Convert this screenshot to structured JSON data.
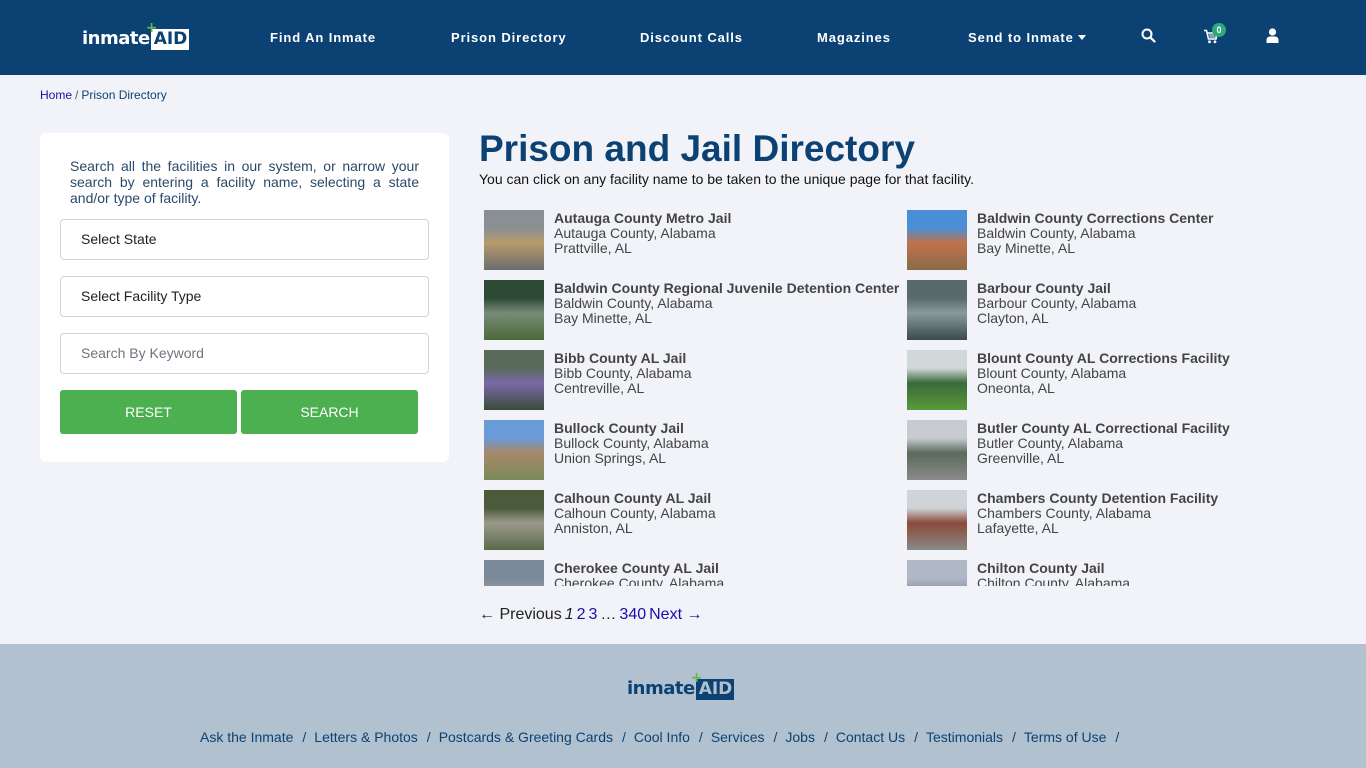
{
  "header": {
    "logo_text": "inmate",
    "logo_accent": "AID",
    "logo_plus": "+",
    "nav": [
      {
        "label": "Find An Inmate"
      },
      {
        "label": "Prison Directory"
      },
      {
        "label": "Discount Calls"
      },
      {
        "label": "Magazines"
      },
      {
        "label": "Send to Inmate",
        "has_dropdown": true
      }
    ],
    "icons": [
      "search-icon",
      "cart-icon",
      "user-icon"
    ],
    "cart_count": "0"
  },
  "breadcrumb": {
    "home": "Home",
    "separator": "/",
    "current": "Prison Directory"
  },
  "search_panel": {
    "description": "Search all the facilities in our system, or narrow your search by entering a facility name, selecting a state and/or type of facility.",
    "state_select": "Select State",
    "type_select": "Select Facility Type",
    "keyword_placeholder": "Search By Keyword",
    "reset_label": "RESET",
    "search_label": "SEARCH"
  },
  "main": {
    "title": "Prison and Jail Directory",
    "subtitle": "You can click on any facility name to be taken to the unique page for that facility.",
    "facilities": [
      {
        "name": "Autauga County Metro Jail",
        "county": "Autauga County, Alabama",
        "city": "Prattville, AL",
        "thumb": [
          "#8a8f94",
          "#b89a6a",
          "#6b6d6e"
        ]
      },
      {
        "name": "Baldwin County Corrections Center",
        "county": "Baldwin County, Alabama",
        "city": "Bay Minette, AL",
        "thumb": [
          "#4a8fd6",
          "#c0724a",
          "#8a6a4a"
        ]
      },
      {
        "name": "Baldwin County Regional Juvenile Detention Center",
        "county": "Baldwin County, Alabama",
        "city": "Bay Minette, AL",
        "thumb": [
          "#2c4a34",
          "#7a8a78",
          "#4a6a3a"
        ]
      },
      {
        "name": "Barbour County Jail",
        "county": "Barbour County, Alabama",
        "city": "Clayton, AL",
        "thumb": [
          "#5a6a6a",
          "#8a9a9a",
          "#3a4a4a"
        ]
      },
      {
        "name": "Bibb County AL Jail",
        "county": "Bibb County, Alabama",
        "city": "Centreville, AL",
        "thumb": [
          "#5a6a5a",
          "#7a6aa8",
          "#3a4a3a"
        ]
      },
      {
        "name": "Blount County AL Corrections Facility",
        "county": "Blount County, Alabama",
        "city": "Oneonta, AL",
        "thumb": [
          "#d0d8d8",
          "#3a6a3a",
          "#5a9a3a"
        ]
      },
      {
        "name": "Bullock County Jail",
        "county": "Bullock County, Alabama",
        "city": "Union Springs, AL",
        "thumb": [
          "#6a9ad8",
          "#a8886a",
          "#7a8a5a"
        ]
      },
      {
        "name": "Butler County AL Correctional Facility",
        "county": "Butler County, Alabama",
        "city": "Greenville, AL",
        "thumb": [
          "#c8ccd0",
          "#5a6a5a",
          "#8a8a8a"
        ]
      },
      {
        "name": "Calhoun County AL Jail",
        "county": "Calhoun County, Alabama",
        "city": "Anniston, AL",
        "thumb": [
          "#4a5a3a",
          "#9a9a8a",
          "#5a6a4a"
        ]
      },
      {
        "name": "Chambers County Detention Facility",
        "county": "Chambers County, Alabama",
        "city": "Lafayette, AL",
        "thumb": [
          "#d0d4d8",
          "#8a4a3a",
          "#8a8a88"
        ]
      },
      {
        "name": "Cherokee County AL Jail",
        "county": "Cherokee County, Alabama",
        "city": "",
        "thumb": [
          "#7a8a9a",
          "#9a9aa0",
          "#6a6a6a"
        ]
      },
      {
        "name": "Chilton County Jail",
        "county": "Chilton County, Alabama",
        "city": "",
        "thumb": [
          "#b0b8c8",
          "#8a9098",
          "#5a6a7a"
        ]
      }
    ]
  },
  "pagination": {
    "previous": "← Previous",
    "current": "1",
    "pages": [
      "2",
      "3"
    ],
    "ellipsis": "…",
    "last": "340",
    "next": "Next →"
  },
  "footer": {
    "links": [
      "Ask the Inmate",
      "Letters & Photos",
      "Postcards & Greeting Cards",
      "Cool Info",
      "Services",
      "Jobs",
      "Contact Us",
      "Testimonials",
      "Terms of Use"
    ],
    "separator": "/"
  },
  "colors": {
    "brand_navy": "#0c4273",
    "button_green": "#4caf50",
    "badge_green": "#2bab7c",
    "footer_bg": "#b1c1cf",
    "page_bg": "#f1f3f8",
    "link_blue": "#1a0dab"
  }
}
